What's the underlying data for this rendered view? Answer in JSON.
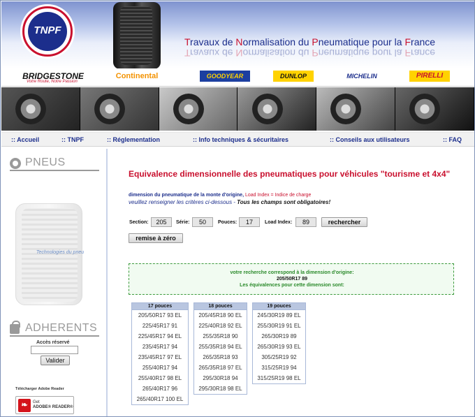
{
  "header": {
    "logo_text": "TNPF",
    "site_title_parts": [
      "T",
      "ravaux de ",
      "N",
      "ormalisation du ",
      "P",
      "neumatique pour la ",
      "F",
      "rance"
    ]
  },
  "brands": {
    "bridgestone": "BRIDGESTONE",
    "bridgestone_tagline": "Votre Route, Notre Passion",
    "continental": "Continental",
    "goodyear": "GOODYEAR",
    "dunlop": "DUNLOP",
    "michelin": "MICHELIN",
    "pirelli": "PIRELLI"
  },
  "nav": {
    "accueil": ":: Accueil",
    "tnpf": ":: TNPF",
    "reglementation": ":: Réglementation",
    "info": ":: Info techniques & sécuritaires",
    "conseils": ":: Conseils aux utilisateurs",
    "faq": ":: FAQ"
  },
  "sidebar": {
    "pneus_title": "PNEUS",
    "tyre_label": "Technologies du pneu",
    "adherents_title": "ADHERENTS",
    "acces_label": "Accès réservé",
    "acces_value": "",
    "valider": "Valider",
    "adobe_label": "Télécharger Adobe Reader",
    "adobe_get": "Get",
    "adobe_name": "ADOBE® READER®"
  },
  "main": {
    "title": "Equivalence dimensionnelle des pneumatiques pour véhicules \"tourisme et 4x4\"",
    "intro_line1_a": "dimension du pneumatique de la monte d'origine,",
    "intro_line1_b": " Load Index = Indice de charge",
    "intro_line2_a": "veuillez renseigner les critères ci-dessous - ",
    "intro_line2_b": "Tous les champs sont obligatoires!",
    "section_label": "Section:",
    "section_value": "205",
    "serie_label": "Série:",
    "serie_value": "50",
    "pouces_label": "Pouces:",
    "pouces_value": "17",
    "load_label": "Load Index:",
    "load_value": "89",
    "search_button": "rechercher",
    "reset_button": "remise à zéro",
    "result_line1": "votre recherche correspond à la dimension d'origine:",
    "result_line2": "205/50R17 89",
    "result_line3": "Les équivalences pour cette dimension sont:"
  },
  "columns": [
    {
      "header": "17 pouces",
      "rows": [
        "205/50R17 93 EL",
        "225/45R17 91",
        "225/45R17 94 EL",
        "235/45R17 94",
        "235/45R17 97 EL",
        "255/40R17 94",
        "255/40R17 98 EL",
        "265/40R17 96",
        "265/40R17 100 EL"
      ]
    },
    {
      "header": "18 pouces",
      "rows": [
        "205/45R18 90 EL",
        "225/40R18 92 EL",
        "255/35R18 90",
        "255/35R18 94 EL",
        "265/35R18 93",
        "265/35R18 97 EL",
        "295/30R18 94",
        "295/30R18 98 EL"
      ]
    },
    {
      "header": "19 pouces",
      "rows": [
        "245/30R19 89 EL",
        "255/30R19 91 EL",
        "265/30R19 89",
        "265/30R19 93 EL",
        "305/25R19 92",
        "315/25R19 94",
        "315/25R19 98 EL"
      ]
    }
  ]
}
